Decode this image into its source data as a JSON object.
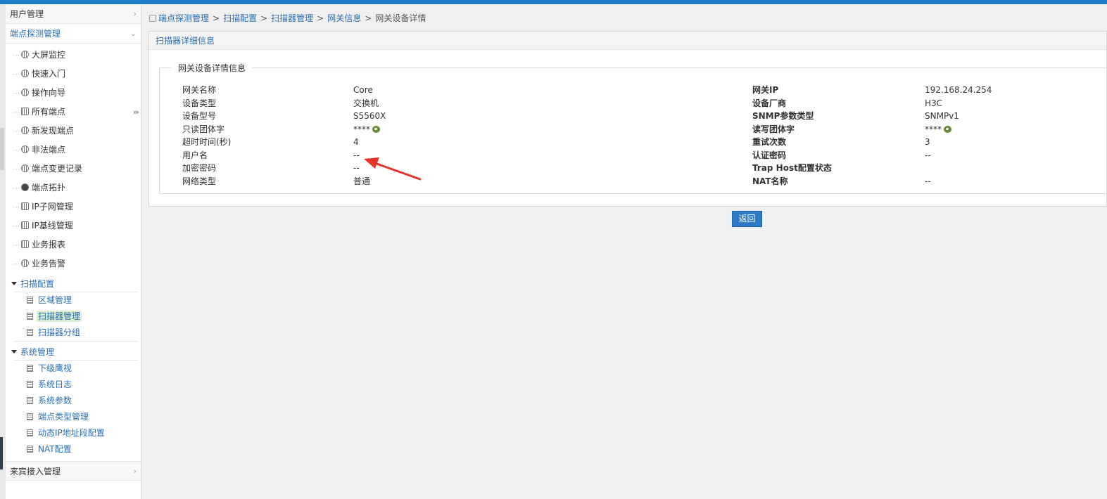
{
  "sidebar": {
    "groups": {
      "user_mgmt": "用户管理",
      "endpoint_mgmt": "端点探测管理",
      "guest_access": "来宾接入管理"
    },
    "items": [
      {
        "label": "大屏监控",
        "icon": "monitor-icon"
      },
      {
        "label": "快速入门",
        "icon": "gear-icon"
      },
      {
        "label": "操作向导",
        "icon": "wizard-icon"
      },
      {
        "label": "所有端点",
        "icon": "grid-icon",
        "more": "›››"
      },
      {
        "label": "新发现端点",
        "icon": "target-icon"
      },
      {
        "label": "非法端点",
        "icon": "gear-icon"
      },
      {
        "label": "端点变更记录",
        "icon": "history-icon"
      },
      {
        "label": "端点拓扑",
        "icon": "topology-icon"
      },
      {
        "label": "IP子网管理",
        "icon": "chart-icon"
      },
      {
        "label": "IP基线管理",
        "icon": "qr-icon"
      },
      {
        "label": "业务报表",
        "icon": "report-icon"
      },
      {
        "label": "业务告警",
        "icon": "alarm-icon"
      }
    ],
    "scan_config": {
      "title": "扫描配置",
      "items": [
        "区域管理",
        "扫描器管理",
        "扫描器分组"
      ]
    },
    "system_mgmt": {
      "title": "系统管理",
      "items": [
        "下级鹰视",
        "系统日志",
        "系统参数",
        "端点类型管理",
        "动态IP地址段配置",
        "NAT配置"
      ]
    }
  },
  "breadcrumb": {
    "items": [
      "端点探测管理",
      "扫描配置",
      "扫描器管理",
      "网关信息"
    ],
    "current": "网关设备详情",
    "separator": ">"
  },
  "panel": {
    "title": "扫描器详细信息",
    "legend": "网关设备详情信息"
  },
  "details": {
    "rows": [
      {
        "l1": "网关名称",
        "v1": "Core",
        "l2": "网关IP",
        "v2": "192.168.24.254"
      },
      {
        "l1": "设备类型",
        "v1": "交换机",
        "l2": "设备厂商",
        "v2": "H3C"
      },
      {
        "l1": "设备型号",
        "v1": "S5560X",
        "l2": "SNMP参数类型",
        "v2": "SNMPv1"
      },
      {
        "l1": "只读团体字",
        "v1": "****",
        "l2": "读写团体字",
        "v2": "****"
      },
      {
        "l1": "超时时间(秒)",
        "v1": "4",
        "l2": "重试次数",
        "v2": "3"
      },
      {
        "l1": "用户名",
        "v1": "--",
        "l2": "认证密码",
        "v2": "--"
      },
      {
        "l1": "加密密码",
        "v1": "--",
        "l2": "Trap Host配置状态",
        "v2": ""
      },
      {
        "l1": "网络类型",
        "v1": "普通",
        "l2": "NAT名称",
        "v2": "--"
      }
    ]
  },
  "actions": {
    "back_label": "返回"
  },
  "colors": {
    "accent": "#2a6fb5",
    "topbar": "#1e7bc8",
    "button": "#2f7ac4",
    "annotation_arrow": "#e8332a"
  }
}
